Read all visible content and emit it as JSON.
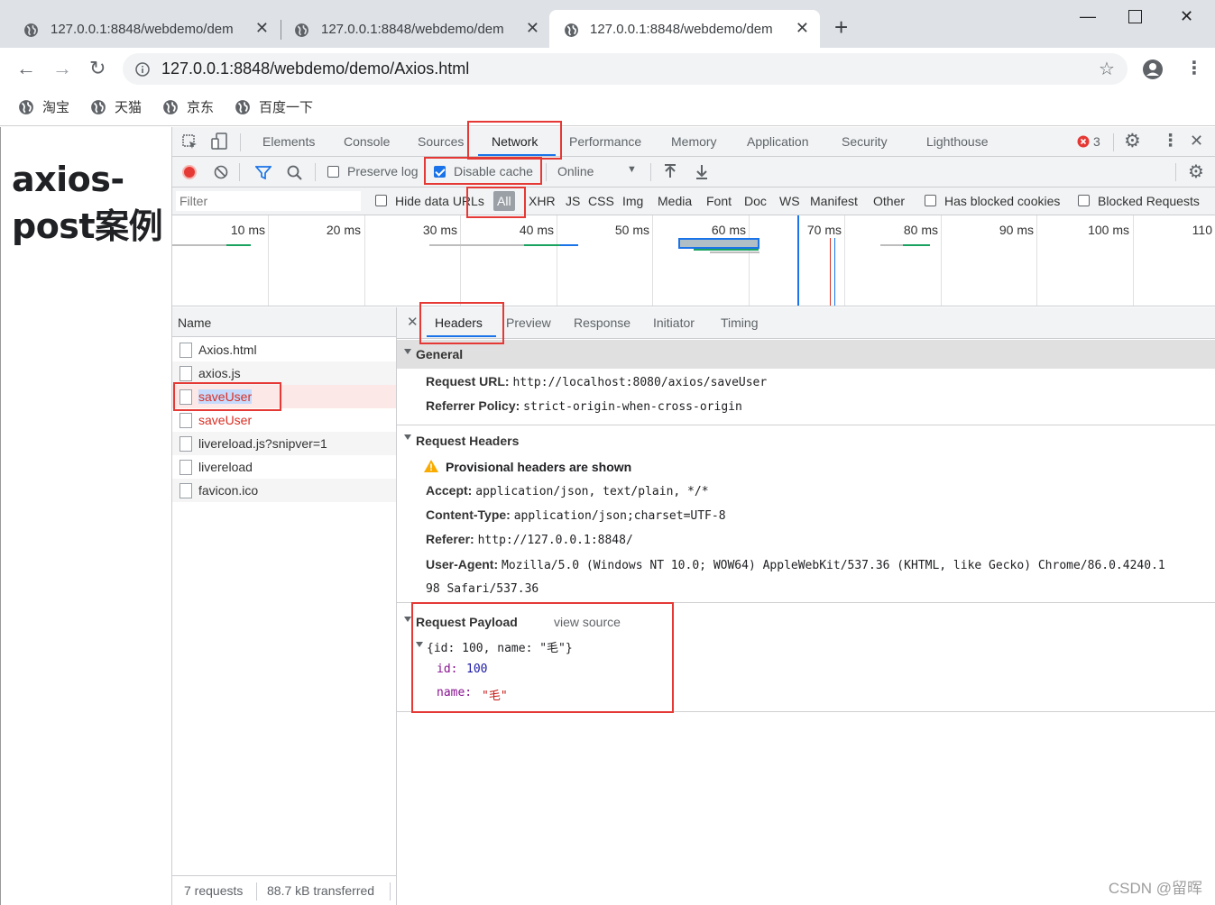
{
  "browser": {
    "tabs": [
      {
        "title": "127.0.0.1:8848/webdemo/dem",
        "active": false
      },
      {
        "title": "127.0.0.1:8848/webdemo/dem",
        "active": false
      },
      {
        "title": "127.0.0.1:8848/webdemo/dem",
        "active": true
      }
    ],
    "address": "127.0.0.1:8848/webdemo/demo/Axios.html",
    "bookmarks": [
      "淘宝",
      "天猫",
      "京东",
      "百度一下"
    ]
  },
  "page": {
    "heading": "axios-post案例"
  },
  "devtools": {
    "tabs": [
      "Elements",
      "Console",
      "Sources",
      "Network",
      "Performance",
      "Memory",
      "Application",
      "Security",
      "Lighthouse"
    ],
    "selected_tab": "Network",
    "error_count": "3",
    "toolbar": {
      "preserve_log": "Preserve log",
      "preserve_log_checked": false,
      "disable_cache": "Disable cache",
      "disable_cache_checked": true,
      "throttling": "Online"
    },
    "filter": {
      "placeholder": "Filter",
      "hide_data_urls": "Hide data URLs",
      "types": [
        "All",
        "XHR",
        "JS",
        "CSS",
        "Img",
        "Media",
        "Font",
        "Doc",
        "WS",
        "Manifest",
        "Other"
      ],
      "has_blocked_cookies": "Has blocked cookies",
      "blocked_requests": "Blocked Requests"
    },
    "timeline_ticks": [
      "10 ms",
      "20 ms",
      "30 ms",
      "40 ms",
      "50 ms",
      "60 ms",
      "70 ms",
      "80 ms",
      "90 ms",
      "100 ms",
      "110"
    ],
    "name_header": "Name",
    "requests": [
      {
        "name": "Axios.html",
        "error": false,
        "selected": false
      },
      {
        "name": "axios.js",
        "error": false,
        "selected": false
      },
      {
        "name": "saveUser",
        "error": true,
        "selected": true
      },
      {
        "name": "saveUser",
        "error": true,
        "selected": false
      },
      {
        "name": "livereload.js?snipver=1",
        "error": false,
        "selected": false
      },
      {
        "name": "livereload",
        "error": false,
        "selected": false
      },
      {
        "name": "favicon.ico",
        "error": false,
        "selected": false
      }
    ],
    "status": {
      "requests": "7 requests",
      "transferred": "88.7 kB transferred"
    },
    "detail_tabs": [
      "Headers",
      "Preview",
      "Response",
      "Initiator",
      "Timing"
    ],
    "general": {
      "title": "General",
      "request_url_label": "Request URL:",
      "request_url": "http://localhost:8080/axios/saveUser",
      "referrer_policy_label": "Referrer Policy:",
      "referrer_policy": "strict-origin-when-cross-origin"
    },
    "request_headers": {
      "title": "Request Headers",
      "warning": "Provisional headers are shown",
      "accept_label": "Accept:",
      "accept": "application/json, text/plain, */*",
      "content_type_label": "Content-Type:",
      "content_type": "application/json;charset=UTF-8",
      "referer_label": "Referer:",
      "referer": "http://127.0.0.1:8848/",
      "user_agent_label": "User-Agent:",
      "user_agent_line1": "Mozilla/5.0 (Windows NT 10.0; WOW64) AppleWebKit/537.36 (KHTML, like Gecko) Chrome/86.0.4240.1",
      "user_agent_line2": "98 Safari/537.36"
    },
    "payload": {
      "title": "Request Payload",
      "view_source": "view source",
      "summary": "{id: 100, name: \"毛\"}",
      "id_key": "id:",
      "id_value": "100",
      "name_key": "name:",
      "name_value": "\"毛\""
    }
  },
  "watermark": "CSDN @留晖"
}
